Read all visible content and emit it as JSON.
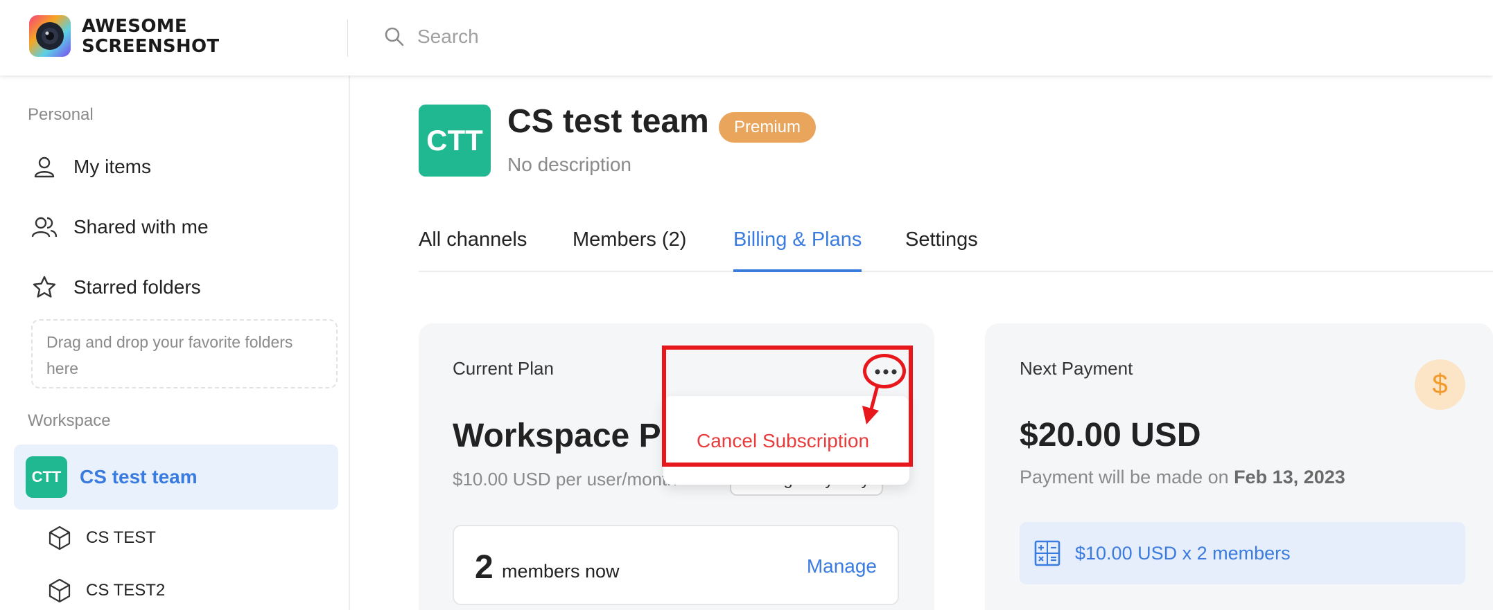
{
  "brand": {
    "name_line1": "AWESOME",
    "name_line2": "SCREENSHOT"
  },
  "search": {
    "placeholder": "Search"
  },
  "sidebar": {
    "personal_heading": "Personal",
    "items": [
      {
        "label": "My items",
        "icon": "user-icon"
      },
      {
        "label": "Shared with me",
        "icon": "users-icon"
      },
      {
        "label": "Starred folders",
        "icon": "star-icon"
      }
    ],
    "dropzone_text": "Drag and drop your favorite folders here",
    "workspace_heading": "Workspace",
    "team": {
      "initials": "CTT",
      "name": "CS test team"
    },
    "channels": [
      {
        "label": "CS TEST",
        "icon": "cube-icon"
      },
      {
        "label": "CS TEST2",
        "icon": "cube-icon"
      }
    ]
  },
  "team": {
    "initials": "CTT",
    "name": "CS test team",
    "badge": "Premium",
    "description": "No description"
  },
  "tabs": [
    {
      "label": "All channels"
    },
    {
      "label": "Members (2)"
    },
    {
      "label": "Billing & Plans",
      "active": true
    },
    {
      "label": "Settings"
    }
  ],
  "current_plan": {
    "label": "Current Plan",
    "plan_name": "Workspace Pr",
    "price": "$10.00 USD per user/month",
    "change_button": "Change to yearly",
    "members_count": "2",
    "members_text": "members now",
    "manage_label": "Manage",
    "menu": {
      "cancel_label": "Cancel Subscription"
    }
  },
  "next_payment": {
    "label": "Next Payment",
    "currency_symbol": "$",
    "amount": "$20.00 USD",
    "note_prefix": "Payment will be made on",
    "date": "Feb 13, 2023",
    "breakdown": "$10.00 USD x 2 members"
  },
  "colors": {
    "accent": "#3a7be0",
    "team_green": "#1fb891",
    "premium": "#e9a55b",
    "danger": "#e93b3b",
    "annotation": "#e8171b"
  }
}
